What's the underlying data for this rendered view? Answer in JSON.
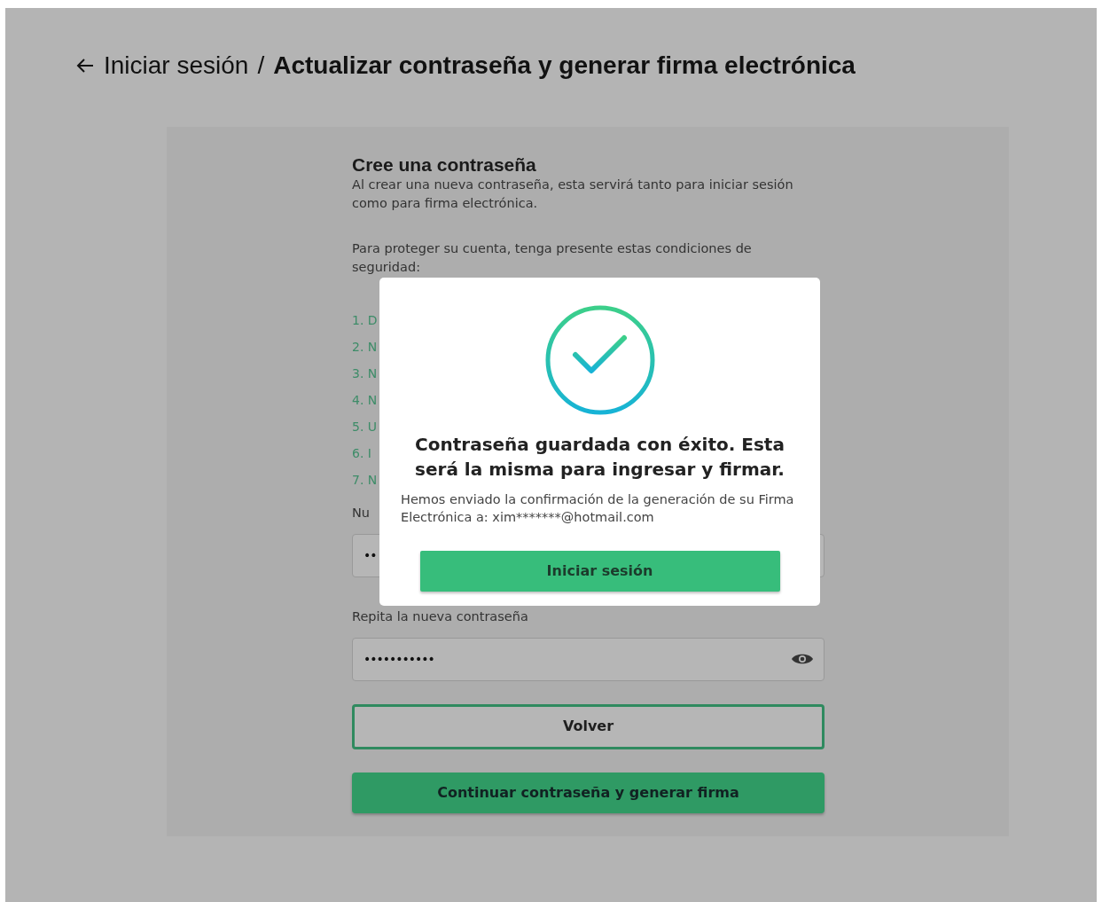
{
  "header": {
    "breadcrumb_link": "Iniciar sesión",
    "separator": "/",
    "title": "Actualizar contraseña y generar firma electrónica"
  },
  "form": {
    "title": "Cree una contraseña",
    "description": "Al crear una nueva contraseña, esta servirá tanto para iniciar sesión como para firma electrónica.",
    "conditions_intro": "Para proteger su cuenta, tenga presente estas condiciones de seguridad:",
    "conditions": [
      "1. D",
      "2. N",
      "3. N",
      "4. N",
      "5. U",
      "6. I",
      "7. N"
    ],
    "new_password": {
      "label": "Nu",
      "value": "••"
    },
    "repeat_password": {
      "label": "Repita la nueva contraseña",
      "value": "•••••••••••"
    },
    "buttons": [
      {
        "label": "Volver",
        "kind": "outline"
      },
      {
        "label": "Continuar contraseña y generar firma",
        "kind": "primary"
      }
    ]
  },
  "modal": {
    "title": "Contraseña guardada con éxito. Esta será la misma para ingresar y firmar.",
    "message": "Hemos enviado la confirmación de la generación de su Firma Electrónica a: xim*******@hotmail.com",
    "button": "Iniciar sesión"
  }
}
